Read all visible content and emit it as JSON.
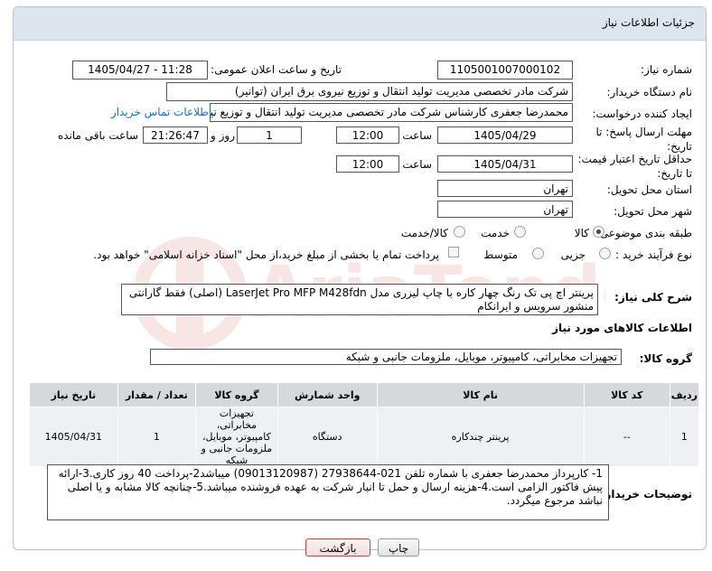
{
  "header": {
    "title": "جزئیات اطلاعات نیاز"
  },
  "form": {
    "need_number_label": "شماره نیاز:",
    "need_number": "1105001007000102",
    "announce_label": "تاریخ و ساعت اعلان عمومی:",
    "announce_value": "1405/04/27 - 11:28",
    "buyer_label": "نام دستگاه خریدار:",
    "buyer_value": "شرکت مادر تخصصی مدیریت تولید  انتقال و توزیع نیروی برق ایران (توانیر)",
    "requester_label": "ایجاد کننده درخواست:",
    "requester_value": "محمدرضا جعفری کارشناس شرکت مادر تخصصی مدیریت تولید  انتقال و توزیع نیر",
    "contact_link": "اطلاعات تماس خریدار",
    "send_deadline_label": "مهلت ارسال پاسخ: تا تاریخ:",
    "send_date": "1405/04/29",
    "time_label": "ساعت",
    "send_time": "12:00",
    "days_value": "1",
    "days_label": "روز و",
    "remaining_time": "21:26:47",
    "remaining_label": "ساعت باقی مانده",
    "price_deadline_label": "حداقل تاریخ اعتبار قیمت: تا تاریخ:",
    "price_date": "1405/04/31",
    "price_time": "12:00",
    "province_label": "استان محل تحویل:",
    "province_value": "تهران",
    "city_label": "شهر محل تحویل:",
    "city_value": "تهران",
    "category_label": "طبقه بندی موضوعی:",
    "category_options": [
      "کالا",
      "خدمت",
      "کالا/خدمت"
    ],
    "category_selected": "کالا",
    "process_label": "نوع فرآیند خرید :",
    "process_options": [
      "جزیی",
      "متوسط"
    ],
    "payment_note": "پرداخت تمام یا بخشی از مبلغ خرید،از محل \"اسناد خزانه اسلامی\" خواهد بود."
  },
  "description": {
    "label": "شرح کلی نیاز:",
    "text": "پرینتر اچ پی تک رنگ چهار کاره با چاپ لیزری مدل LaserJet Pro MFP M428fdn (اصلی) فقط گارانتی منشور سرویس و ایرانکام"
  },
  "goods_section": {
    "title": "اطلاعات کالاهای مورد نیاز",
    "group_label": "گروه کالا:",
    "group_value": "تجهیزات مخابراتی، کامپیوتر، موبایل، ملزومات جانبی و شبکه"
  },
  "table": {
    "headers": [
      "ردیف",
      "کد کالا",
      "نام کالا",
      "واحد شمارش",
      "گروه کالا",
      "تعداد / مقدار",
      "تاریخ نیاز"
    ],
    "rows": [
      {
        "row": "1",
        "code": "--",
        "name": "پرینتر چندکاره",
        "unit": "دستگاه",
        "group": "تجهیزات مخابراتی، کامپیوتر، موبایل، ملزومات جانبی و شبکه",
        "qty": "1",
        "date": "1405/04/31"
      }
    ]
  },
  "buyer_notes": {
    "label": "توضیحات خریدار:",
    "text": "1- کارپرداز محمدرضا جعفری با شماره تلفن 021-27938644  (09013120987) میباشد2-پرداخت 40 روز کاری.3-ارائه پیش فاکتور الزامی است.4-هزینه ارسال و حمل تا انبار شرکت به عهده فروشنده میباشد.5-چنانچه کالا مشابه و یا اصلی نباشد مرجوع میگردد."
  },
  "buttons": {
    "print": "چاپ",
    "back": "بازگشت"
  },
  "watermark": {
    "text": "AriaTender.net"
  },
  "colors": {
    "header_bg": "#dde6ee",
    "link": "#1a6fbf",
    "back_border": "#c24040"
  }
}
